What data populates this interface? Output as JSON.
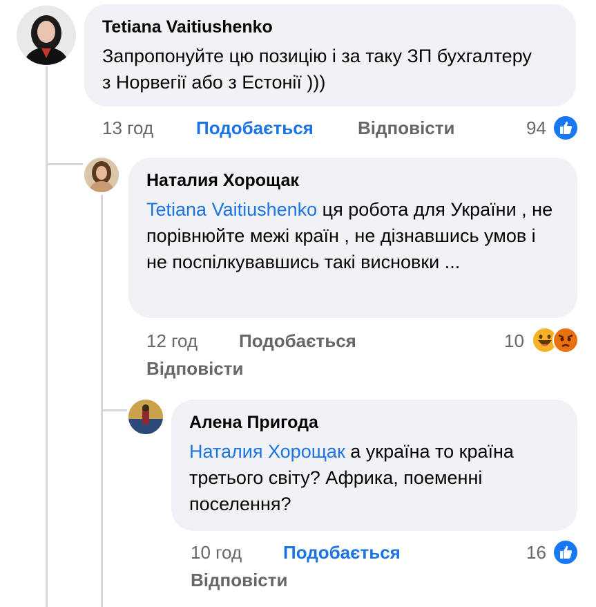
{
  "comments": [
    {
      "author": "Tetiana Vaitiushenko",
      "text": "Запропонуйте цю позицію і за таку ЗП бухгалтеру з Норвегії або з Естонії  )))",
      "time": "13 год",
      "like_label": "Подобається",
      "reply_label": "Відповісти",
      "reaction_count": "94",
      "reactions": [
        "like-icon"
      ]
    },
    {
      "author": "Наталия Хорощак",
      "mention": "Tetiana Vaitiushenko",
      "text": " ця робота для України , не порівнюйте межі країн , не дізнавшись умов і не поспілкувавшись такі висновки ...",
      "time": "12 год",
      "like_label": "Подобається",
      "reply_label": "Відповісти",
      "reaction_count": "10",
      "reactions": [
        "haha-icon",
        "angry-icon"
      ]
    },
    {
      "author": "Алена Пригода",
      "mention": "Наталия Хорощак",
      "text": " а україна то країна третього світу? Африка, поеменні поселення?",
      "time": "10 год",
      "like_label": "Подобається",
      "reply_label": "Відповісти",
      "reaction_count": "16",
      "reactions": [
        "like-icon"
      ]
    }
  ],
  "colors": {
    "accent": "#1b74e4",
    "bubble": "#f0f2f5",
    "secondary_text": "#65676b",
    "like_reaction": "#1877f2",
    "haha_reaction": "#f7b125",
    "angry_reaction": "#e9710f"
  }
}
